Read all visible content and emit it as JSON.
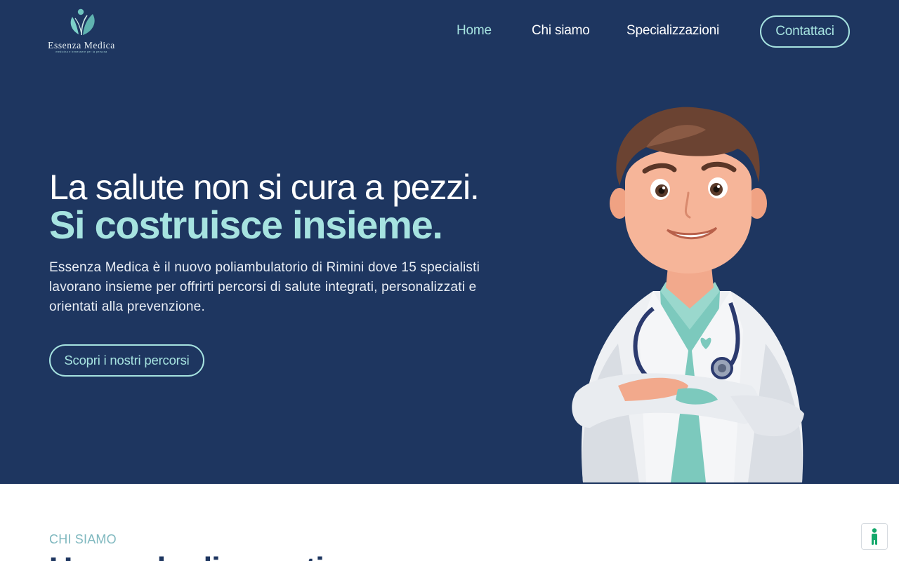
{
  "brand": {
    "name": "Essenza Medica",
    "tagline": "medicina e benessere per la persona"
  },
  "nav": {
    "items": [
      {
        "label": "Home",
        "active": true
      },
      {
        "label": "Chi siamo",
        "active": false
      },
      {
        "label": "Specializzazioni",
        "active": false
      }
    ],
    "cta_label": "Contattaci"
  },
  "hero": {
    "title_line1": "La salute non si cura a pezzi.",
    "title_line2": "Si costruisce insieme.",
    "description": "Essenza Medica è il nuovo poliambulatorio di Rimini dove 15 specialisti lavorano insieme per offrirti percorsi di salute integrati, personalizzati e orientati alla prevenzione.",
    "cta_label": "Scopri i nostri percorsi"
  },
  "about": {
    "eyebrow": "CHI SIAMO",
    "title": "Un modo di curarti"
  },
  "icons": {
    "logo": "leaf-figure-icon",
    "accessibility": "accessibility-icon",
    "doctor": "doctor-illustration"
  },
  "colors": {
    "hero_bg": "#1e3660",
    "accent": "#a6e3e0",
    "white": "#ffffff",
    "eyebrow": "#7fb8bf",
    "accessibility_green": "#13a86b"
  }
}
